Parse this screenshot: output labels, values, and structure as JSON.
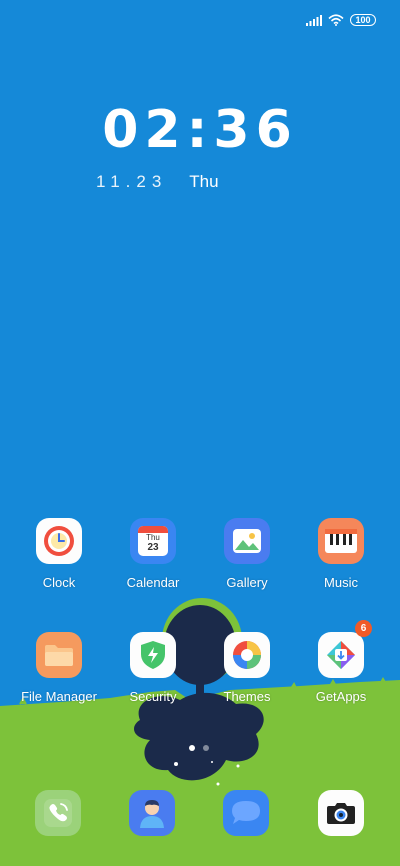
{
  "status": {
    "battery": "100"
  },
  "clock": {
    "time": "02:36",
    "date": "11.23",
    "weekday": "Thu"
  },
  "apps_row1": [
    {
      "label": "Clock"
    },
    {
      "label": "Calendar",
      "icon_weekday": "Thu",
      "icon_day": "23"
    },
    {
      "label": "Gallery"
    },
    {
      "label": "Music"
    }
  ],
  "apps_row2": [
    {
      "label": "File Manager"
    },
    {
      "label": "Security"
    },
    {
      "label": "Themes"
    },
    {
      "label": "GetApps",
      "badge": "6"
    }
  ],
  "dock": [
    {
      "name": "phone-app",
      "icon": "phone-icon"
    },
    {
      "name": "contacts-app",
      "icon": "contact-icon"
    },
    {
      "name": "messages-app",
      "icon": "message-icon"
    },
    {
      "name": "camera-app",
      "icon": "camera-icon"
    }
  ],
  "page_indicator": {
    "pages": 2,
    "current": 1
  },
  "colors": {
    "sky": "#1589d8",
    "grass": "#7dc23a",
    "tree": "#1b2a4a"
  }
}
